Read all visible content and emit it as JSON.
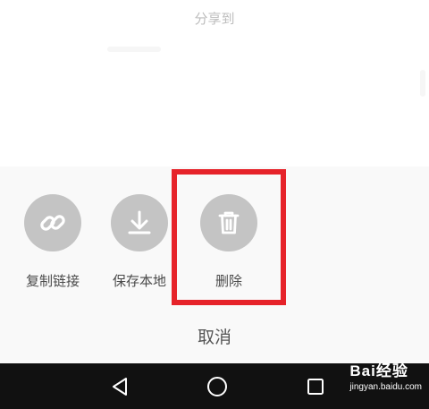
{
  "sheet": {
    "title": "分享到"
  },
  "actions": [
    {
      "label": "复制链接",
      "icon": "link-icon"
    },
    {
      "label": "保存本地",
      "icon": "download-icon"
    },
    {
      "label": "删除",
      "icon": "trash-icon"
    }
  ],
  "cancel_label": "取消",
  "navbar": {
    "back_icon": "back-triangle-icon",
    "home_icon": "home-circle-icon",
    "recents_icon": "recents-square-icon"
  },
  "watermark": {
    "main": "Bai经验",
    "sub": "jingyan.baidu.com"
  },
  "colors": {
    "highlight": "#e6232a",
    "icon_circle": "#c4c4c4",
    "navbar": "#111111"
  }
}
